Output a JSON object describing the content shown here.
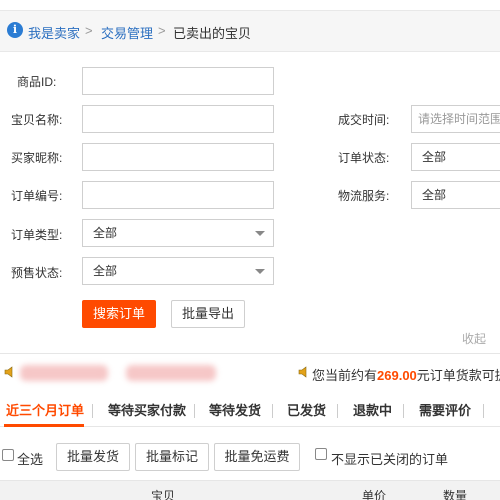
{
  "breadcrumb": {
    "items": [
      {
        "label": "我是卖家"
      },
      {
        "label": "交易管理"
      },
      {
        "label": "已卖出的宝贝"
      }
    ],
    "separator": ">"
  },
  "filters": {
    "item_id_label": "商品ID:",
    "item_name_label": "宝贝名称:",
    "buyer_nick_label": "买家昵称:",
    "order_no_label": "订单编号:",
    "order_type_label": "订单类型:",
    "order_type_value": "全部",
    "presale_label": "预售状态:",
    "presale_value": "全部",
    "deal_time_label": "成交时间:",
    "deal_time_placeholder": "请选择时间范围",
    "order_status_label": "订单状态:",
    "order_status_value": "全部",
    "logistics_label": "物流服务:",
    "logistics_value": "全部"
  },
  "actions": {
    "search_label": "搜索订单",
    "export_label": "批量导出",
    "collapse_label": "收起"
  },
  "notice": {
    "prefix": "您当前约有",
    "amount": "269.00",
    "suffix": "元订单货款可提"
  },
  "tabs": [
    {
      "label": "近三个月订单",
      "active": true
    },
    {
      "label": "等待买家付款"
    },
    {
      "label": "等待发货"
    },
    {
      "label": "已发货"
    },
    {
      "label": "退款中"
    },
    {
      "label": "需要评价"
    }
  ],
  "bulk": {
    "select_all_label": "全选",
    "ship_label": "批量发货",
    "mark_label": "批量标记",
    "free_ship_label": "批量免运费",
    "hide_closed_label": "不显示已关闭的订单"
  },
  "table_headers": {
    "item": "宝贝",
    "price": "单价",
    "quantity": "数量"
  },
  "colors": {
    "accent": "#ff4a00",
    "link": "#2b6fc0",
    "info_icon": "#2b7cd3"
  }
}
